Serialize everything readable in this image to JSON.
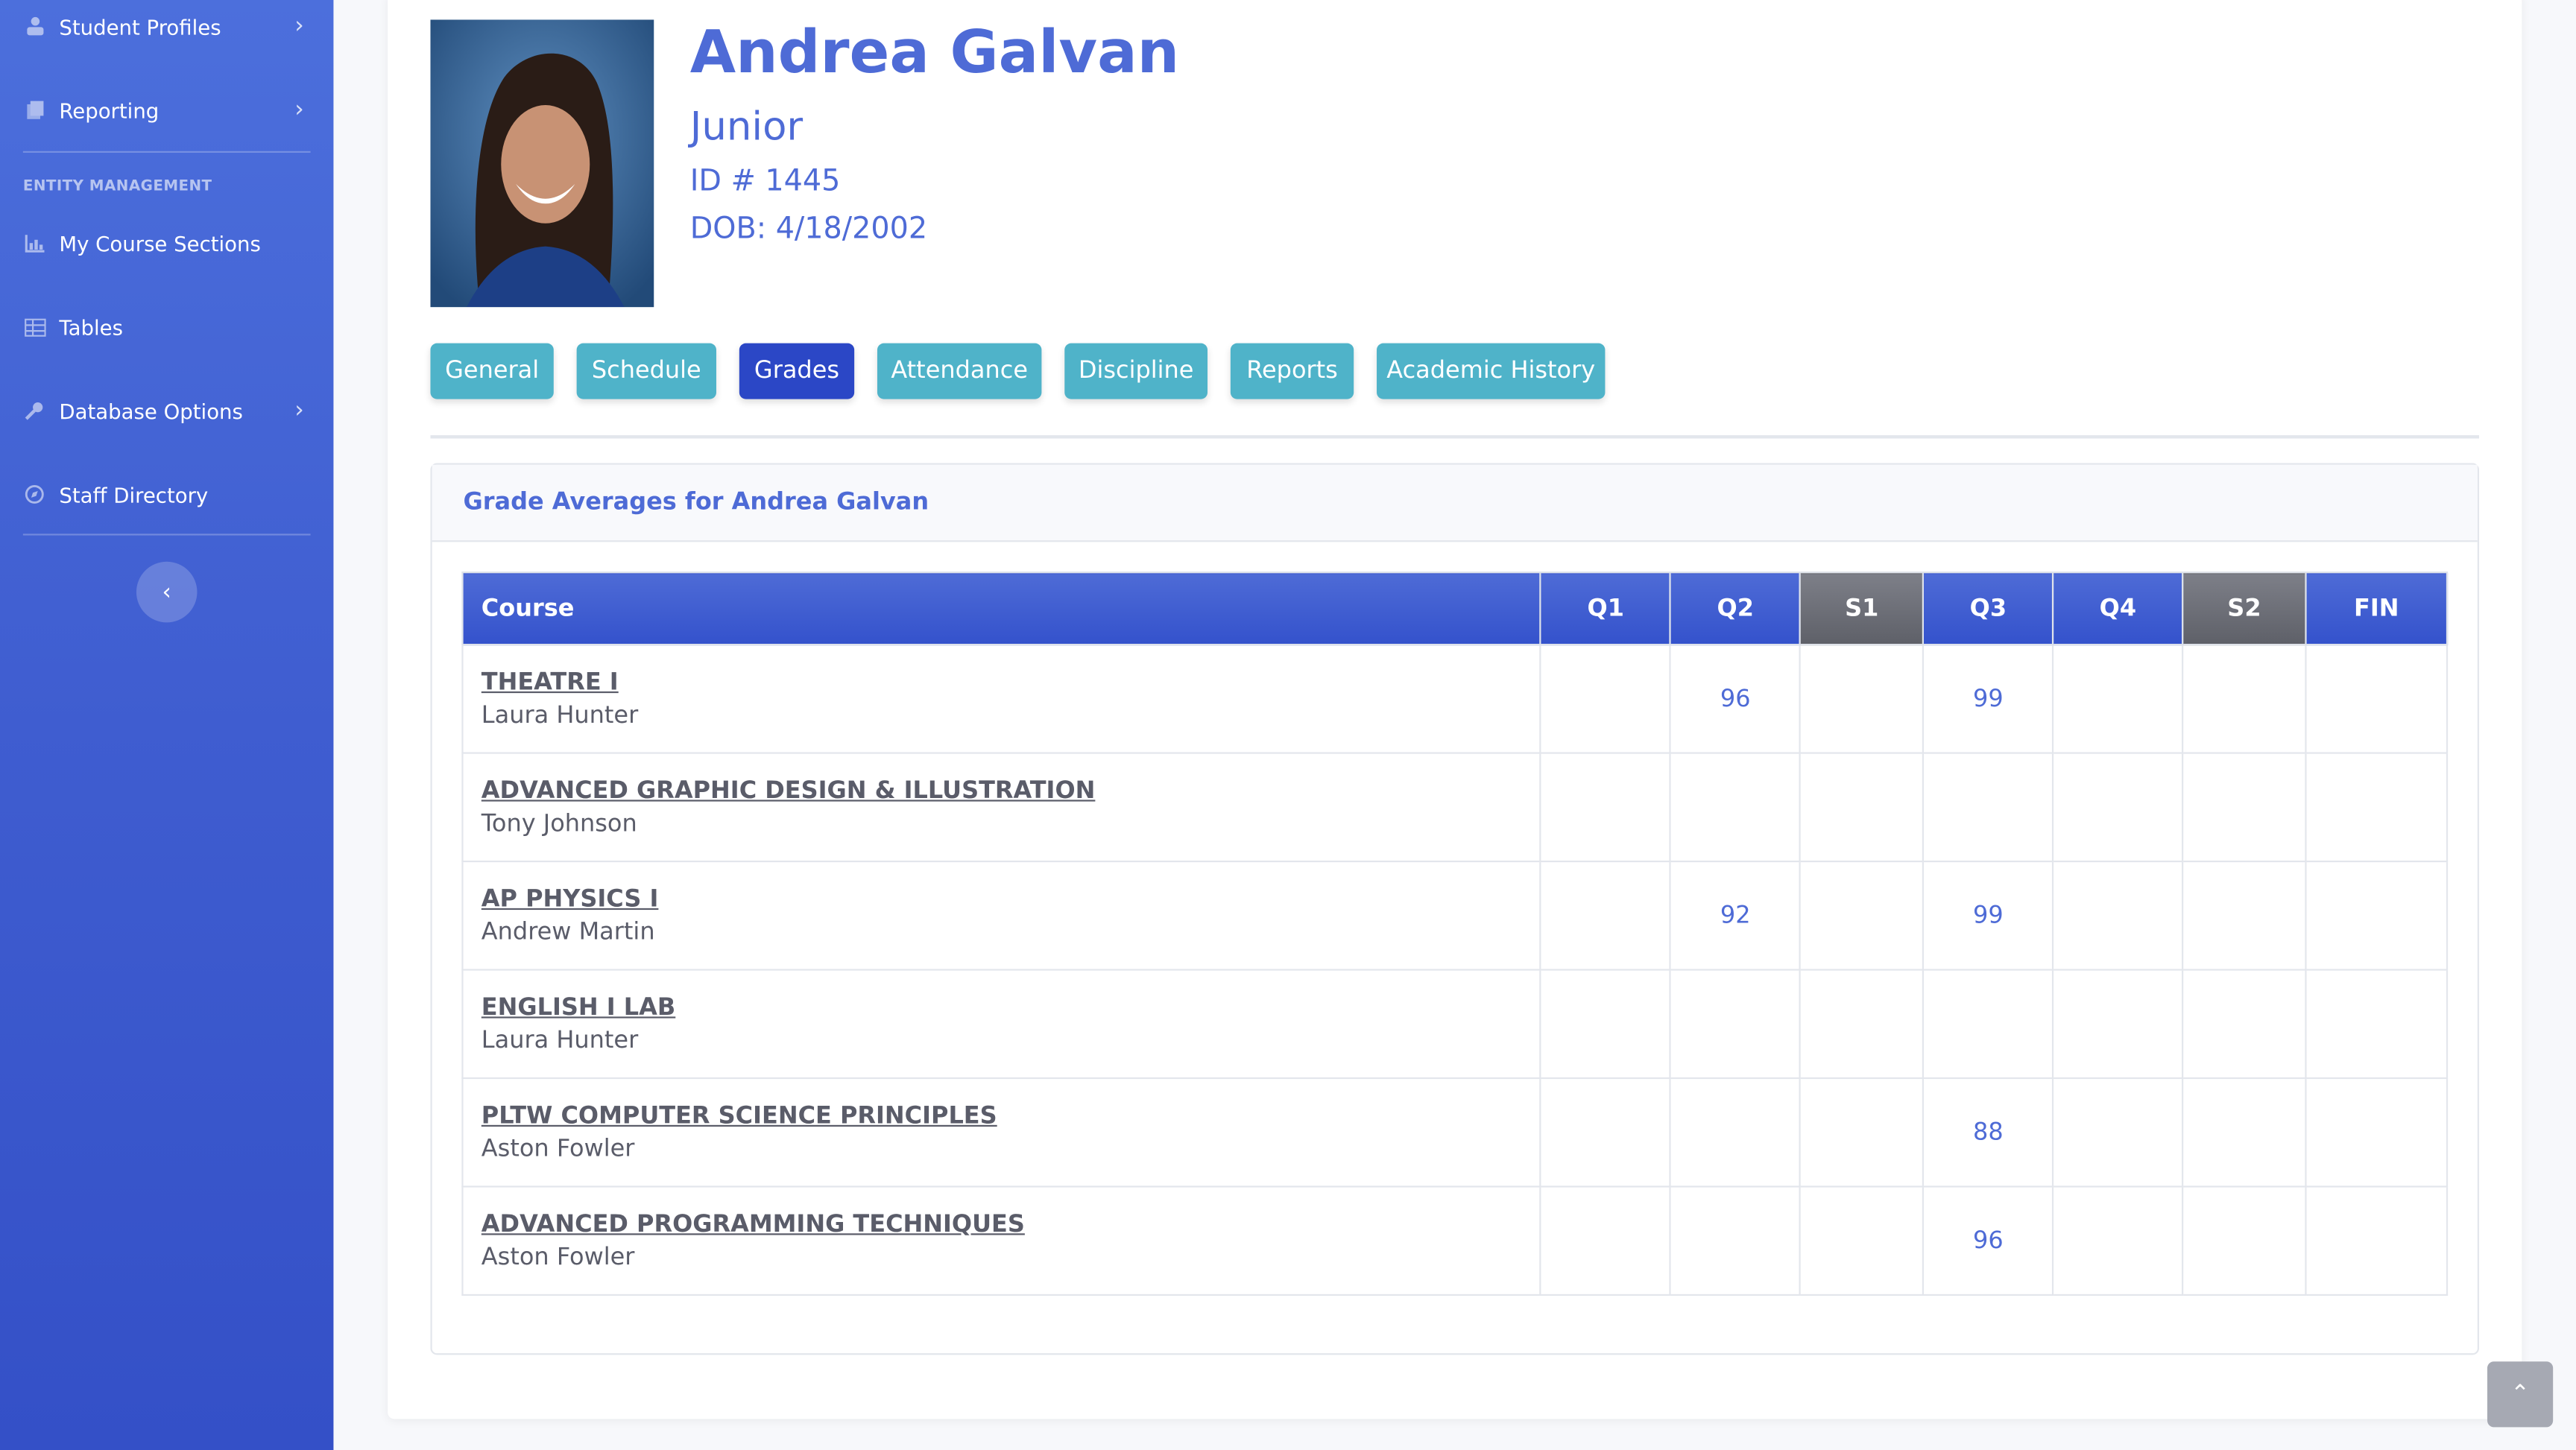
{
  "sidebar": {
    "items": [
      {
        "label": "Student Profiles",
        "icon": "user-icon"
      },
      {
        "label": "Reporting",
        "icon": "copy-icon"
      },
      {
        "label": "My Course Sections",
        "icon": "chart-icon"
      },
      {
        "label": "Tables",
        "icon": "table-icon"
      },
      {
        "label": "Database Options",
        "icon": "wrench-icon"
      },
      {
        "label": "Staff Directory",
        "icon": "compass-icon"
      }
    ],
    "heading": "ENTITY MANAGEMENT"
  },
  "student": {
    "name": "Andrea Galvan",
    "grade_level": "Junior",
    "id_line": "ID # 1445",
    "dob_line": "DOB: 4/18/2002"
  },
  "tabs": [
    {
      "label": "General"
    },
    {
      "label": "Schedule"
    },
    {
      "label": "Grades"
    },
    {
      "label": "Attendance"
    },
    {
      "label": "Discipline"
    },
    {
      "label": "Reports"
    },
    {
      "label": "Academic History"
    }
  ],
  "grades": {
    "title": "Grade Averages for Andrea Galvan",
    "columns": [
      "Course",
      "Q1",
      "Q2",
      "S1",
      "Q3",
      "Q4",
      "S2",
      "FIN"
    ],
    "rows": [
      {
        "course": "THEATRE I",
        "teacher": "Laura Hunter",
        "q1": "",
        "q2": "96",
        "s1": "",
        "q3": "99",
        "q4": "",
        "s2": "",
        "fin": ""
      },
      {
        "course": "ADVANCED GRAPHIC DESIGN & ILLUSTRATION",
        "teacher": "Tony Johnson",
        "q1": "",
        "q2": "",
        "s1": "",
        "q3": "",
        "q4": "",
        "s2": "",
        "fin": ""
      },
      {
        "course": "AP PHYSICS I",
        "teacher": "Andrew Martin",
        "q1": "",
        "q2": "92",
        "s1": "",
        "q3": "99",
        "q4": "",
        "s2": "",
        "fin": ""
      },
      {
        "course": "ENGLISH I LAB",
        "teacher": "Laura Hunter",
        "q1": "",
        "q2": "",
        "s1": "",
        "q3": "",
        "q4": "",
        "s2": "",
        "fin": ""
      },
      {
        "course": "PLTW COMPUTER SCIENCE PRINCIPLES",
        "teacher": "Aston Fowler",
        "q1": "",
        "q2": "",
        "s1": "",
        "q3": "88",
        "q4": "",
        "s2": "",
        "fin": ""
      },
      {
        "course": "ADVANCED PROGRAMMING TECHNIQUES",
        "teacher": "Aston Fowler",
        "q1": "",
        "q2": "",
        "s1": "",
        "q3": "96",
        "q4": "",
        "s2": "",
        "fin": ""
      }
    ]
  },
  "colors": {
    "primary": "#4e6bd6",
    "active_tab": "#2b47c6",
    "tab": "#4fb3c9",
    "semester_header": "#6b6d75"
  }
}
